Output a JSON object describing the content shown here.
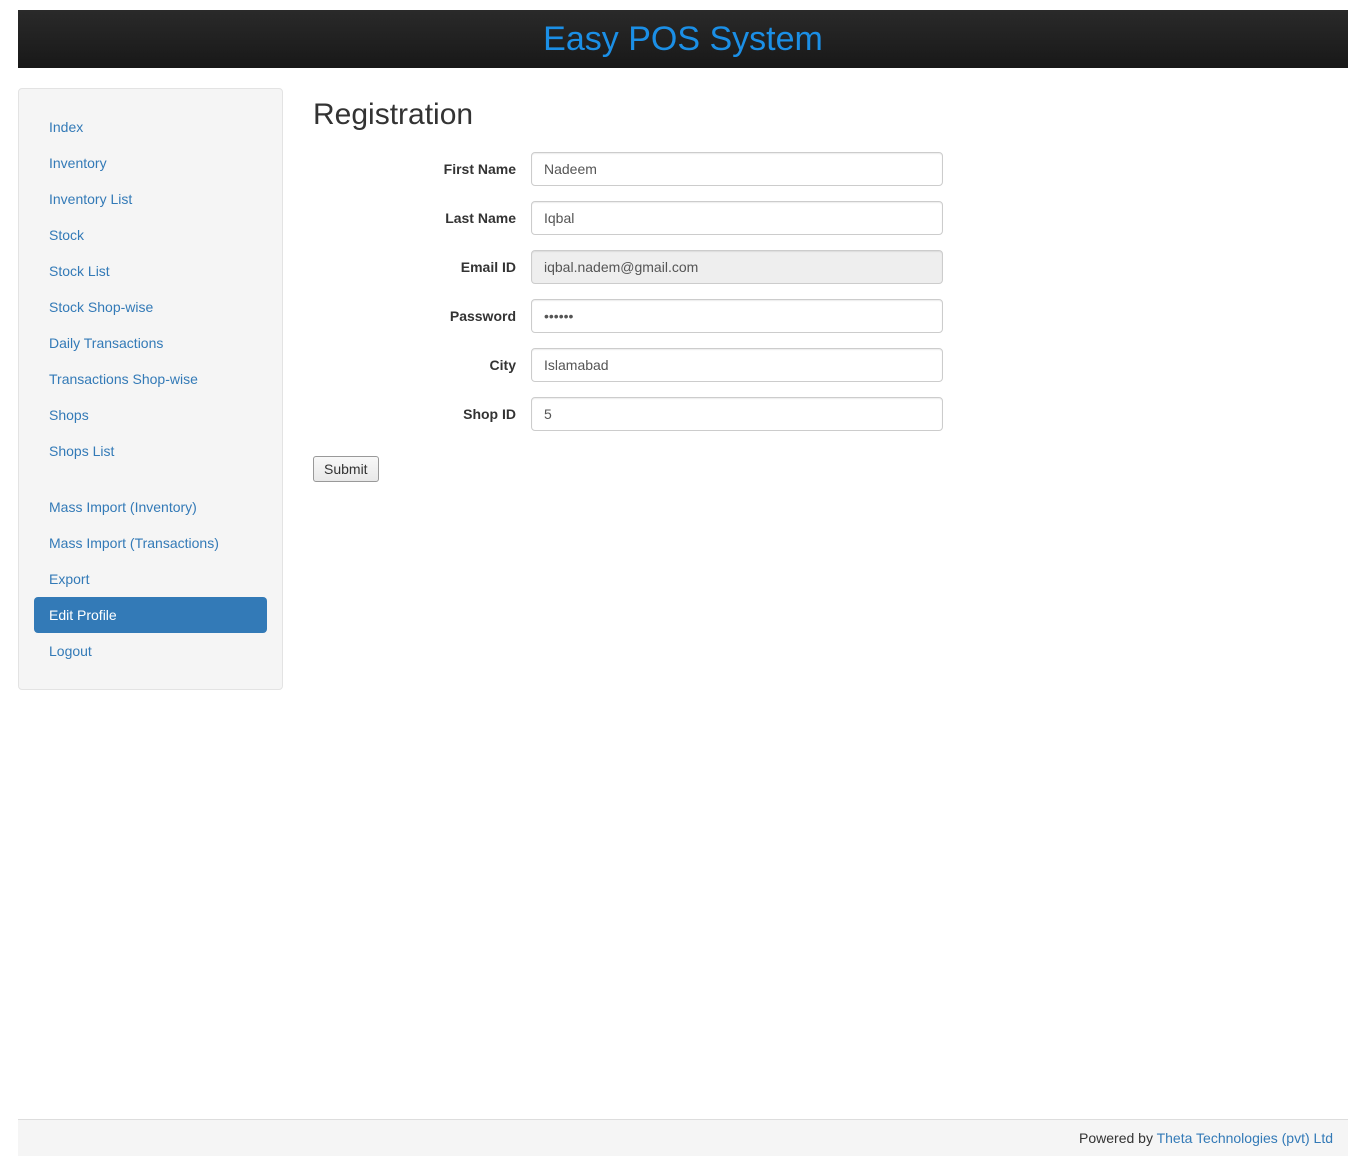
{
  "header": {
    "title": "Easy POS System"
  },
  "sidebar": {
    "items": [
      {
        "label": "Index",
        "active": false
      },
      {
        "label": "Inventory",
        "active": false
      },
      {
        "label": "Inventory List",
        "active": false
      },
      {
        "label": "Stock",
        "active": false
      },
      {
        "label": "Stock List",
        "active": false
      },
      {
        "label": "Stock Shop-wise",
        "active": false
      },
      {
        "label": "Daily Transactions",
        "active": false
      },
      {
        "label": "Transactions Shop-wise",
        "active": false
      },
      {
        "label": "Shops",
        "active": false
      },
      {
        "label": "Shops List",
        "active": false
      }
    ],
    "items2": [
      {
        "label": "Mass Import (Inventory)",
        "active": false
      },
      {
        "label": "Mass Import (Transactions)",
        "active": false
      },
      {
        "label": "Export",
        "active": false
      },
      {
        "label": "Edit Profile",
        "active": true
      },
      {
        "label": "Logout",
        "active": false
      }
    ]
  },
  "main": {
    "title": "Registration",
    "form": {
      "first_name_label": "First Name",
      "first_name_value": "Nadeem",
      "last_name_label": "Last Name",
      "last_name_value": "Iqbal",
      "email_label": "Email ID",
      "email_value": "iqbal.nadem@gmail.com",
      "password_label": "Password",
      "password_value": "••••••",
      "city_label": "City",
      "city_value": "Islamabad",
      "shop_id_label": "Shop ID",
      "shop_id_value": "5",
      "submit_label": "Submit"
    }
  },
  "footer": {
    "powered_by": "Powered by ",
    "company": "Theta Technologies (pvt) Ltd"
  }
}
